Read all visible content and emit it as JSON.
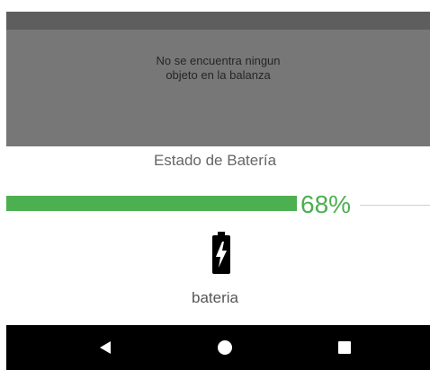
{
  "message": {
    "text": "No se encuentra ningun\nobjeto en la balanza"
  },
  "battery": {
    "title": "Estado de Batería",
    "level_fraction": 0.68,
    "level_text": "68%",
    "label": "bateria",
    "icon": "battery-charging-icon",
    "color": "#4caf50"
  },
  "navigation": {
    "back_icon": "back-triangle-icon",
    "home_icon": "home-circle-icon",
    "recent_icon": "recent-apps-square-icon"
  },
  "colors": {
    "panel": "#777777",
    "status_bar": "#5e5e5e",
    "accent": "#4caf50",
    "nav_bar": "#000000"
  }
}
